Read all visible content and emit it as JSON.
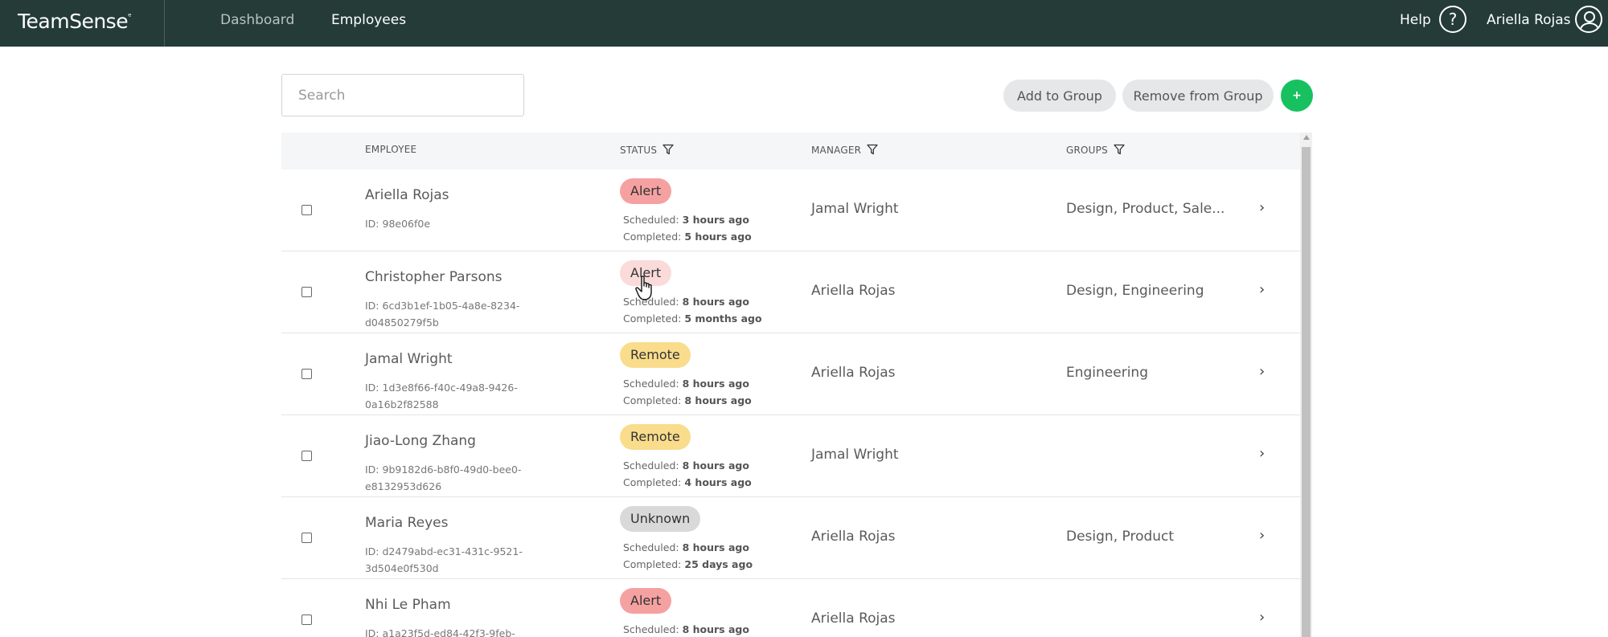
{
  "app": {
    "logo": "TeamSense"
  },
  "nav": {
    "dashboard": "Dashboard",
    "employees": "Employees"
  },
  "header": {
    "help": "Help",
    "user_name": "Ariella Rojas"
  },
  "search": {
    "placeholder": "Search"
  },
  "toolbar": {
    "add_to_group": "Add to Group",
    "remove_from_group": "Remove from Group",
    "add_button": "+"
  },
  "table": {
    "headers": {
      "employee": "EMPLOYEE",
      "status": "STATUS",
      "manager": "MANAGER",
      "groups": "GROUPS"
    },
    "rows": [
      {
        "name": "Ariella Rojas",
        "id": "ID: 98e06f0e",
        "status": "Alert",
        "scheduled_label": "Scheduled:",
        "scheduled": "3 hours ago",
        "completed_label": "Completed:",
        "completed": "5 hours ago",
        "manager": "Jamal Wright",
        "groups": "Design, Product, Sale..."
      },
      {
        "name": "Christopher Parsons",
        "id": "ID: 6cd3b1ef-1b05-4a8e-8234-d04850279f5b",
        "status": "Alert",
        "scheduled_label": "Scheduled:",
        "scheduled": "8 hours ago",
        "completed_label": "Completed:",
        "completed": "5 months ago",
        "manager": "Ariella Rojas",
        "groups": "Design, Engineering"
      },
      {
        "name": "Jamal Wright",
        "id": "ID: 1d3e8f66-f40c-49a8-9426-0a16b2f82588",
        "status": "Remote",
        "scheduled_label": "Scheduled:",
        "scheduled": "8 hours ago",
        "completed_label": "Completed:",
        "completed": "8 hours ago",
        "manager": "Ariella Rojas",
        "groups": "Engineering"
      },
      {
        "name": "Jiao-Long Zhang",
        "id": "ID: 9b9182d6-b8f0-49d0-bee0-e8132953d626",
        "status": "Remote",
        "scheduled_label": "Scheduled:",
        "scheduled": "8 hours ago",
        "completed_label": "Completed:",
        "completed": "4 hours ago",
        "manager": "Jamal Wright",
        "groups": ""
      },
      {
        "name": "Maria Reyes",
        "id": "ID: d2479abd-ec31-431c-9521-3d504e0f530d",
        "status": "Unknown",
        "scheduled_label": "Scheduled:",
        "scheduled": "8 hours ago",
        "completed_label": "Completed:",
        "completed": "25 days ago",
        "manager": "Ariella Rojas",
        "groups": "Design, Product"
      },
      {
        "name": "Nhi Le Pham",
        "id": "ID: a1a23f5d-ed84-42f3-9feb-",
        "status": "Alert",
        "scheduled_label": "Scheduled:",
        "scheduled": "8 hours ago",
        "completed_label": "",
        "completed": "",
        "manager": "Ariella Rojas",
        "groups": ""
      }
    ]
  },
  "colors": {
    "topbar": "#243b37",
    "alert": "#f6a1a1",
    "alert_hover": "#fbdada",
    "remote": "#f9dc8c",
    "unknown": "#d9d9d9",
    "add_button": "#17c15f"
  },
  "icons": [
    "help-icon",
    "user-avatar-icon",
    "filter-icon",
    "chevron-right-icon",
    "hand-cursor-icon"
  ]
}
